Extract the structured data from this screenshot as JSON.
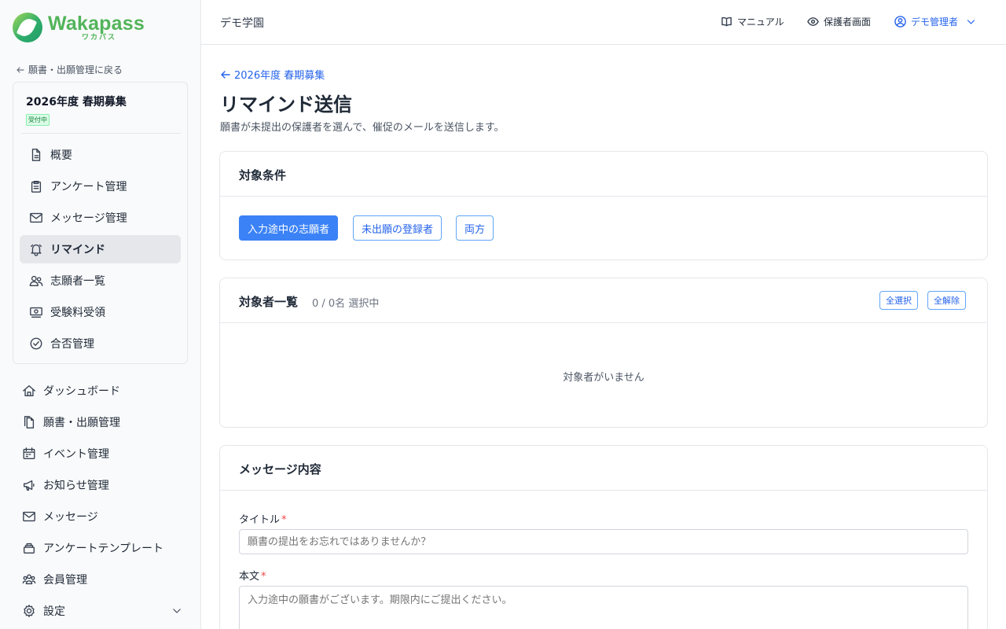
{
  "brand": {
    "name": "Wakapass",
    "kana": "ワカパス"
  },
  "sidebar": {
    "back_label": "願書・出願管理に戻る",
    "recruit": {
      "title": "2026年度 春期募集",
      "status": "受付中"
    },
    "sub_items": [
      {
        "label": "概要",
        "icon": "document-icon"
      },
      {
        "label": "アンケート管理",
        "icon": "clipboard-icon"
      },
      {
        "label": "メッセージ管理",
        "icon": "mail-icon"
      },
      {
        "label": "リマインド",
        "icon": "bell-icon",
        "active": true
      },
      {
        "label": "志願者一覧",
        "icon": "users-icon"
      },
      {
        "label": "受験料受領",
        "icon": "money-icon"
      },
      {
        "label": "合否管理",
        "icon": "check-circle-icon"
      }
    ],
    "main_items": [
      {
        "label": "ダッシュボード",
        "icon": "home-icon"
      },
      {
        "label": "願書・出願管理",
        "icon": "files-icon"
      },
      {
        "label": "イベント管理",
        "icon": "calendar-icon"
      },
      {
        "label": "お知らせ管理",
        "icon": "megaphone-icon"
      },
      {
        "label": "メッセージ",
        "icon": "mail-icon"
      },
      {
        "label": "アンケートテンプレート",
        "icon": "stack-icon"
      },
      {
        "label": "会員管理",
        "icon": "group-icon"
      },
      {
        "label": "設定",
        "icon": "gear-icon"
      }
    ]
  },
  "header": {
    "school": "デモ学園",
    "manual": "マニュアル",
    "guardian_view": "保護者画面",
    "user": "デモ管理者"
  },
  "page": {
    "breadcrumb": "2026年度 春期募集",
    "title": "リマインド送信",
    "description": "願書が未提出の保護者を選んで、催促のメールを送信します。"
  },
  "conditions": {
    "title": "対象条件",
    "options": [
      "入力途中の志願者",
      "未出願の登録者",
      "両方"
    ],
    "selected": "入力途中の志願者"
  },
  "targets": {
    "title": "対象者一覧",
    "count": "0 / 0名 選択中",
    "select_all": "全選択",
    "deselect_all": "全解除",
    "empty": "対象者がいません"
  },
  "message": {
    "title": "メッセージ内容",
    "subject_label": "タイトル",
    "subject_placeholder": "願書の提出をお忘れではありませんか？",
    "body_label": "本文",
    "body_placeholder": "入力途中の願書がございます。期限内にご提出ください。",
    "required_mark": "*"
  },
  "colors": {
    "accent": "#3b82f6",
    "brand": "#52b45a",
    "active_bg": "#e5e7eb"
  }
}
